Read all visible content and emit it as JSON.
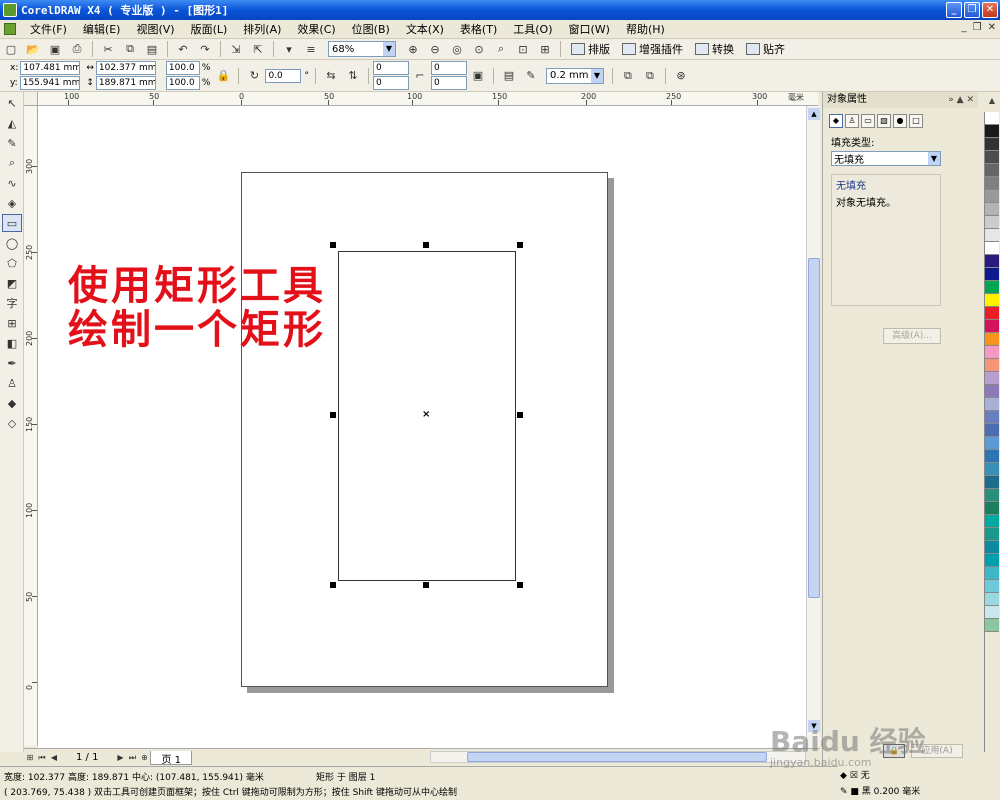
{
  "window": {
    "title": "CorelDRAW X4 ( 专业版 ) - [图形1]",
    "controls": [
      "_",
      "❐",
      "✕"
    ]
  },
  "menu": {
    "items": [
      "文件(F)",
      "编辑(E)",
      "视图(V)",
      "版面(L)",
      "排列(A)",
      "效果(C)",
      "位图(B)",
      "文本(X)",
      "表格(T)",
      "工具(O)",
      "窗口(W)",
      "帮助(H)"
    ],
    "doc_controls": [
      "_",
      "❐",
      "✕"
    ]
  },
  "toolbar": {
    "zoom_value": "68%",
    "layout_label": "排版",
    "plugin_label": "增强插件",
    "convert_label": "转换",
    "snap_label": "贴齐"
  },
  "props": {
    "x_label": "x:",
    "x_value": "107.481 mm",
    "y_label": "y:",
    "y_value": "155.941 mm",
    "w_value": "102.377 mm",
    "h_value": "189.871 mm",
    "scale_x": "100.0",
    "scale_y": "100.0",
    "pct": "%",
    "rotation": "0.0",
    "degree": "°",
    "corner_1": "0",
    "corner_2": "0",
    "corner_3": "0",
    "corner_4": "0",
    "outline_width": "0.2 mm"
  },
  "ruler": {
    "h_labels": [
      "100",
      "50",
      "0",
      "50",
      "100",
      "150",
      "200",
      "250",
      "300"
    ],
    "h_unit": "毫米",
    "v_labels": [
      "300",
      "250",
      "200",
      "150",
      "100",
      "50",
      "0"
    ]
  },
  "canvas": {
    "overlay_line1": "使用矩形工具",
    "overlay_line2": "绘制一个矩形",
    "center_mark": "×"
  },
  "page_nav": {
    "page_count": "1 / 1",
    "page_tab": "页 1"
  },
  "status": {
    "line1": "宽度: 102.377  高度: 189.871  中心: (107.481, 155.941)  毫米",
    "object_info": "矩形 于 图层 1",
    "line2": "( 203.769, 75.438 )     双击工具可创建页面框架；按住 Ctrl 键拖动可限制为方形；按住 Shift 键拖动可从中心绘制"
  },
  "docker": {
    "title": "对象属性",
    "fill_type_label": "填充类型:",
    "fill_type_value": "无填充",
    "group_title": "无填充",
    "group_desc": "对象无填充。",
    "advanced_label": "高级(A)...",
    "apply_label": "应用(A)"
  },
  "indicators": {
    "fill_text": "无",
    "outline_text": "黑  0.200 毫米"
  },
  "palette": {
    "colors": [
      "#ffffff",
      "#1a1a1a",
      "#333333",
      "#4d4d4d",
      "#666666",
      "#808080",
      "#999999",
      "#b3b3b3",
      "#cccccc",
      "#e6e6e6",
      "#ffffff",
      "#2b1a80",
      "#0d1a8c",
      "#00a651",
      "#fff200",
      "#ee1c25",
      "#d4145a",
      "#f7941d",
      "#f49ac1",
      "#f69679",
      "#b7a0cf",
      "#8c7ab8",
      "#a8b0d8",
      "#6a7fc0",
      "#4c6cb3",
      "#5b9bd5",
      "#2e75b6",
      "#3a8fb7",
      "#1d6e8c",
      "#2a8f7a",
      "#1a7f5f",
      "#00a99d",
      "#1b9a8c",
      "#0e8a9e",
      "#009fb0",
      "#3cb8c8",
      "#6ccbd8",
      "#9ad8e0",
      "#c8e8ee",
      "#8bc6a0"
    ]
  },
  "watermark": {
    "text": "Baidu 经验",
    "url": "jingyan.baidu.com"
  }
}
